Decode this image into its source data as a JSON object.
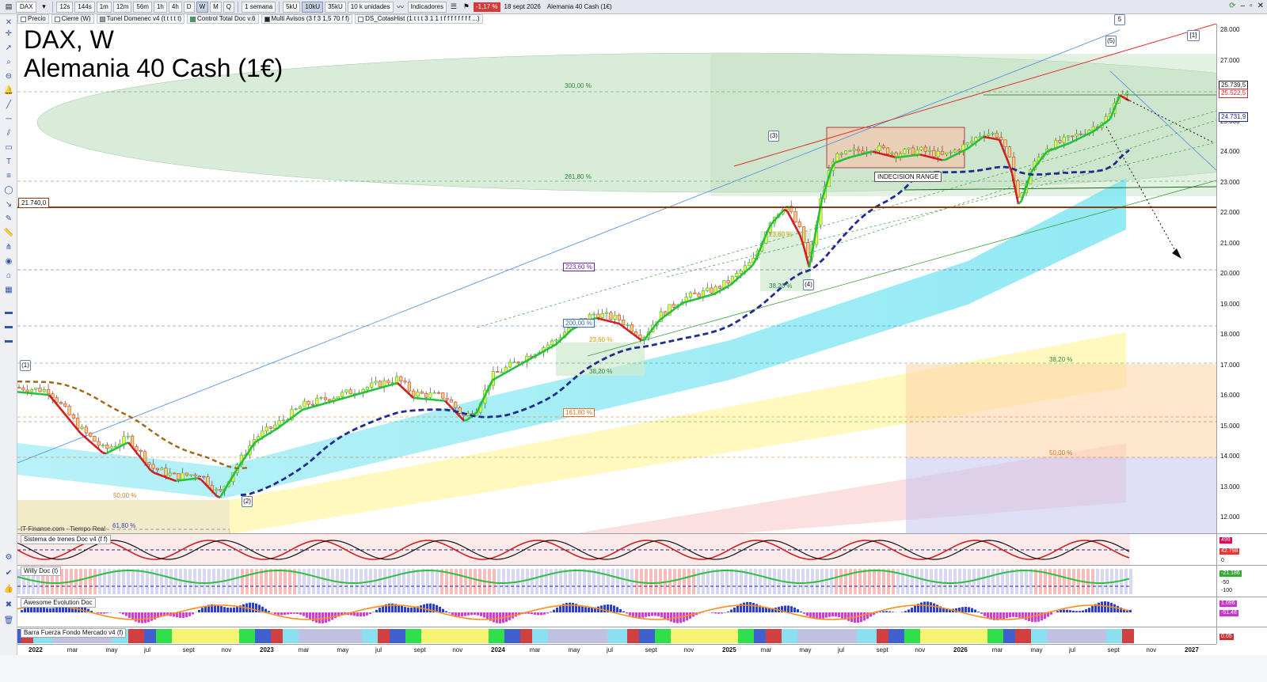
{
  "toolbar": {
    "instrument": "DAX",
    "intervals": [
      "12s",
      "144s",
      "1m",
      "12m",
      "56m",
      "1h",
      "4h",
      "D",
      "W",
      "M",
      "Q"
    ],
    "active_interval": "W",
    "period": "1 semana",
    "units": [
      "5kU",
      "10kU",
      "35kU"
    ],
    "active_unit": "10kU",
    "units_select": "10 k unidades",
    "indicators_label": "Indicadores",
    "change": "-1,17 %",
    "date": "18 sept 2026",
    "instrument_name": "Alemania 40 Cash (1€)"
  },
  "tags": [
    {
      "label": "Precio",
      "color": "#ffffff"
    },
    {
      "label": "Cierre (W)",
      "color": "#ffffff"
    },
    {
      "label": "Tunel Domenec v4 (t t t t t)",
      "color": "#999999"
    },
    {
      "label": "Control Total Doc v.6",
      "color": "#2fa84f"
    },
    {
      "label": "Multi Avisos (3 f 3 1,5 70 f f)",
      "color": "#222222"
    },
    {
      "label": "DS_CotasHist (1 t t t 3 1 1 t f f f f f f f f ...)",
      "color": "#ffffff"
    }
  ],
  "chart": {
    "title": "DAX, W",
    "subtitle": "Alemania 40 Cash (1€)",
    "source": "IT-Finance.com - Tiempo Real",
    "price_ticks": [
      "28.000",
      "27.000",
      "26.000",
      "25.000",
      "24.000",
      "23.000",
      "22.000",
      "21.000",
      "20.000",
      "19.000",
      "18.000",
      "17.000",
      "16.000",
      "15.000",
      "14.000",
      "13.000",
      "12.000"
    ],
    "price_labels": [
      {
        "text": "25.739,5",
        "color": "#111111"
      },
      {
        "text": "25.522,5",
        "color": "#d12b2b"
      },
      {
        "text": "24.731,9",
        "color": "#1a2a8c"
      }
    ],
    "level_label": "21.740,0",
    "fib_labels": [
      "300,00 %",
      "261,80 %",
      "223,60 %",
      "200,00 %",
      "161,80 %",
      "50,00 %",
      "61,80 %",
      "23,60 %",
      "38,20 %",
      "23,60 %",
      "38,20 %",
      "38,20 %",
      "50,00 %"
    ],
    "range_label": "INDECISION RANGE",
    "waves": [
      "(1)",
      "(2)",
      "(3)",
      "(4)",
      "(5)",
      "5",
      "[1]"
    ],
    "x_ticks": [
      "2022",
      "mar",
      "may",
      "jul",
      "sept",
      "nov",
      "2023",
      "mar",
      "may",
      "jul",
      "sept",
      "nov",
      "2024",
      "mar",
      "may",
      "jul",
      "sept",
      "nov",
      "2025",
      "mar",
      "may",
      "jul",
      "sept",
      "nov",
      "2026",
      "mar",
      "may",
      "jul",
      "sept",
      "nov",
      "2027"
    ],
    "colors": {
      "up": "#2fbf3a",
      "down": "#e03232",
      "trend_fast": "#22c13a",
      "trend_fast_down": "#d11e1e",
      "trend_slow": "#1f2d8f",
      "resistance": "#8a3a12"
    }
  },
  "panes": [
    {
      "title": "Sistema de trenes Doc v4 (f f)",
      "axis": [
        "499",
        "42.798",
        "0"
      ]
    },
    {
      "title": "Willy Doc (t)",
      "axis": [
        "-21.186",
        "-50",
        "-100"
      ]
    },
    {
      "title": "Awesome Evolution Doc",
      "axis": [
        "1.096",
        "-51.48"
      ]
    },
    {
      "title": "Barra Fuerza Fondo Mercado v4 (f)",
      "axis": [
        "0.05"
      ]
    }
  ]
}
